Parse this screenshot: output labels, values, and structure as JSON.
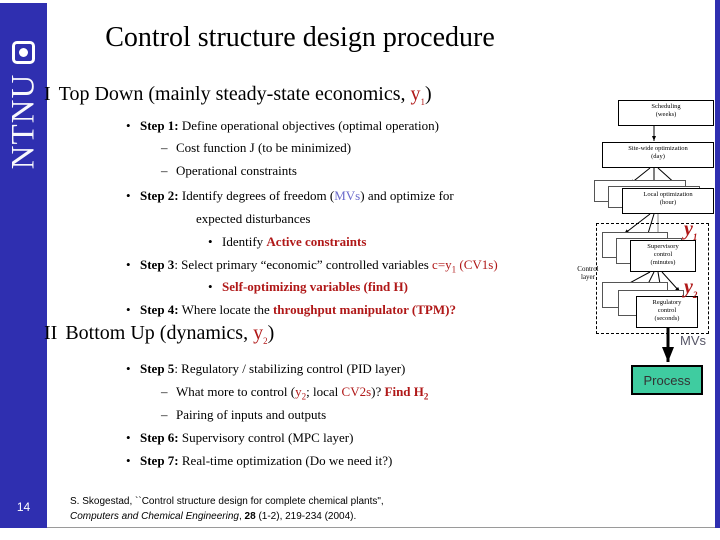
{
  "slide": {
    "page_number": "14",
    "title": "Control structure design procedure",
    "logo_text": "NTNU",
    "colors": {
      "sidebar_blue": "#2F2FB0",
      "accent_red": "#B01818",
      "accent_blue": "#6A6ACB",
      "process_teal": "#3FCCA0"
    }
  },
  "sections": [
    {
      "numeral": "I",
      "heading_plain": "Top Down (mainly steady-state economics, ",
      "heading_var": "y",
      "heading_sub": "1",
      "heading_tail": ")"
    },
    {
      "numeral": "II",
      "heading_plain": "Bottom Up (dynamics, ",
      "heading_var": "y",
      "heading_sub": "2",
      "heading_tail": ")"
    }
  ],
  "steps": {
    "step1_label": "Step 1:",
    "step1_text": "Define operational objectives (optimal operation)",
    "step1_sub1": "Cost function J (to be minimized)",
    "step1_sub2": "Operational constraints",
    "step2_label": "Step 2:",
    "step2_text_a": "Identify degrees of freedom (",
    "step2_mvs": "MVs",
    "step2_text_b": ") and optimize for",
    "step2_cont": "expected disturbances",
    "step2_sub_a": "Identify ",
    "step2_sub_b": "Active constraints",
    "step3_label": "Step 3",
    "step3_text_a": ": Select primary “economic” controlled variables ",
    "step3_c": "c=y",
    "step3_c_sub": "1",
    "step3_cv": " (CV1s)",
    "step3_sub": "Self-optimizing variables (find H)",
    "step4_label": "Step 4:",
    "step4_text_a": "Where locate the ",
    "step4_text_b": "throughput manipulator (TPM)?",
    "step5_label": "Step 5",
    "step5_text": ": Regulatory / stabilizing control (PID layer)",
    "step5_sub1_a": "What more to control (",
    "step5_sub1_y": "y",
    "step5_sub1_ysub": "2",
    "step5_sub1_b": "; local ",
    "step5_sub1_cv": "CV2s",
    "step5_sub1_c": ")? ",
    "step5_sub1_find": "Find H",
    "step5_sub1_findsub": "2",
    "step5_sub2": "Pairing of inputs and outputs",
    "step6_label": "Step 6:",
    "step6_text": "Supervisory control (MPC layer)",
    "step7_label": "Step 7:",
    "step7_text": "Real-time optimization (Do we need it?)"
  },
  "diagram": {
    "boxes": [
      {
        "line1": "Scheduling",
        "line2": "(weeks)"
      },
      {
        "line1": "Site-wide optimization",
        "line2": "(day)"
      },
      {
        "line1": "Local optimization",
        "line2": "(hour)"
      },
      {
        "line1": "Supervisory",
        "line2": "control",
        "line3": "(minutes)"
      },
      {
        "line1": "Regulatory",
        "line2": "control",
        "line3": "(seconds)"
      }
    ],
    "control_layer_label_l1": "Control",
    "control_layer_label_l2": "layer",
    "y1": "y",
    "y1_sub": "1",
    "y2": "y",
    "y2_sub": "2",
    "mvs": "MVs",
    "process": "Process"
  },
  "footer": {
    "line1": "S. Skogestad, ``Control structure design for complete chemical plants\",",
    "journal": "Computers and Chemical Engineering",
    "volume": "28",
    "line2_tail": " (1-2), 219-234 (2004)."
  }
}
